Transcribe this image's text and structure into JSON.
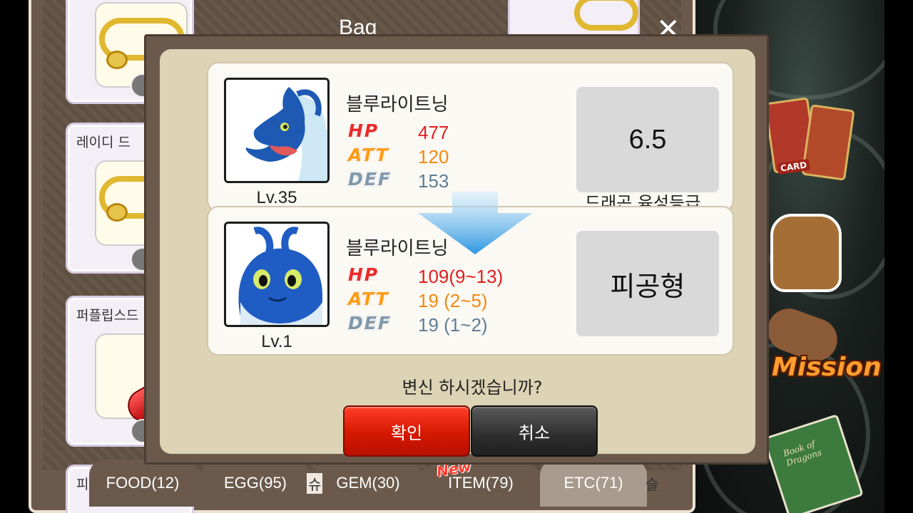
{
  "bag": {
    "title": "Bag",
    "close_icon": "close-icon",
    "items": [
      {
        "name": "",
        "icon": "necklace-icon"
      },
      {
        "name": "레이디 드",
        "icon": "necklace-icon"
      },
      {
        "name": "퍼플립스드",
        "icon": "capsule-icon"
      },
      {
        "name": "피",
        "icon": ""
      }
    ],
    "tabs": [
      {
        "label": "FOOD(12)"
      },
      {
        "label": "EGG(95)"
      },
      {
        "label": "GEM(30)"
      },
      {
        "label": "ITEM(79)"
      },
      {
        "label": "ETC(71)"
      }
    ],
    "new_badge": "New",
    "partial_left": "슈",
    "partial_right": "슬"
  },
  "side_menu": {
    "mission_label": "Mission",
    "card_label": "CARD",
    "book_label": "Book of Dragons"
  },
  "dialog": {
    "current": {
      "name": "블루라이트닝",
      "level": "Lv.35",
      "stats": [
        {
          "label": "HP",
          "value": "477"
        },
        {
          "label": "ATT",
          "value": "120"
        },
        {
          "label": "DEF",
          "value": "153"
        }
      ],
      "grade_value": "6.5",
      "grade_caption": "드래곤 육성등급"
    },
    "result": {
      "name": "블루라이트닝",
      "level": "Lv.1",
      "stats": [
        {
          "label": "HP",
          "value": "109(9~13)"
        },
        {
          "label": "ATT",
          "value": "19  (2~5)"
        },
        {
          "label": "DEF",
          "value": "19  (1~2)"
        }
      ],
      "type_value": "피공형"
    },
    "question": "변신 하시겠습니까?",
    "confirm_label": "확인",
    "cancel_label": "취소"
  },
  "colors": {
    "hp": "#e02020",
    "att": "#f08a10",
    "def": "#5f7d95",
    "confirm": "#d51800",
    "cancel": "#2e2e2e"
  }
}
